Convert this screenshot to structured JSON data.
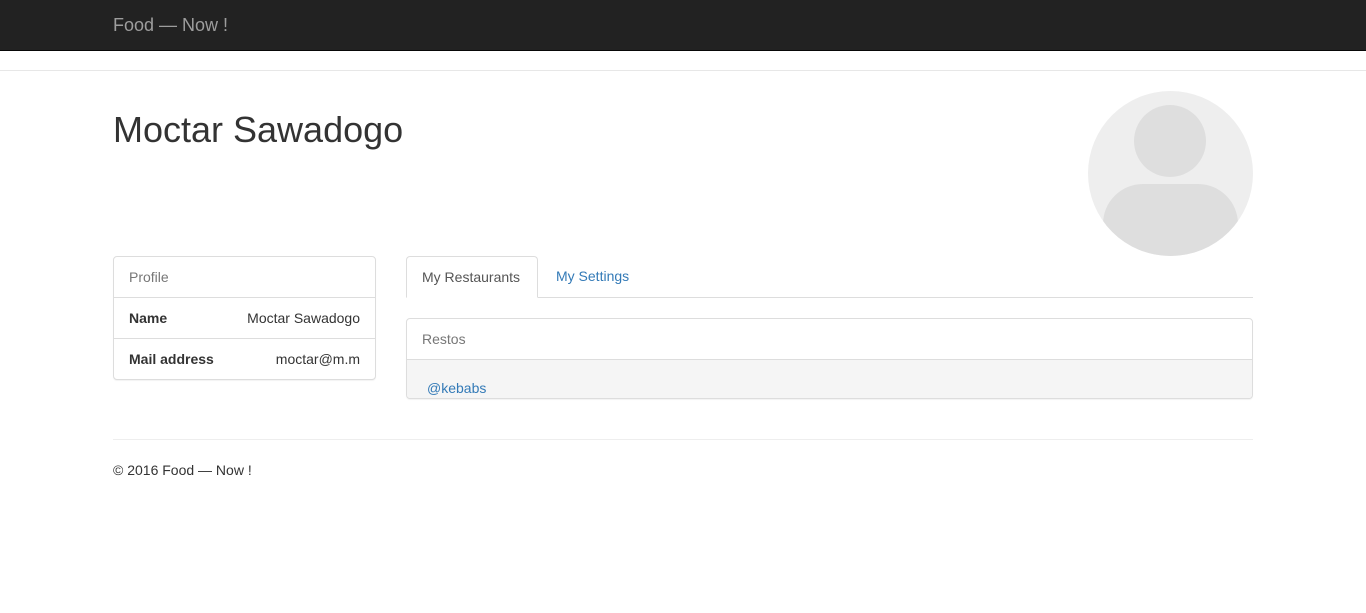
{
  "navbar": {
    "brand": "Food — Now !"
  },
  "profile_header": {
    "name": "Moctar Sawadogo",
    "avatar_icon": "user-placeholder-icon"
  },
  "profile_panel": {
    "heading": "Profile",
    "rows": [
      {
        "label": "Name",
        "value": "Moctar Sawadogo"
      },
      {
        "label": "Mail address",
        "value": "moctar@m.m"
      }
    ]
  },
  "tabs": [
    {
      "label": "My Restaurants",
      "active": true
    },
    {
      "label": "My Settings",
      "active": false
    }
  ],
  "restos_panel": {
    "heading": "Restos",
    "items": [
      "@kebabs"
    ]
  },
  "footer": {
    "text": "© 2016 Food — Now !"
  },
  "colors": {
    "navbar_bg": "#222222",
    "brand_text": "#9d9d9d",
    "link": "#337ab7",
    "panel_border": "#dddddd"
  }
}
